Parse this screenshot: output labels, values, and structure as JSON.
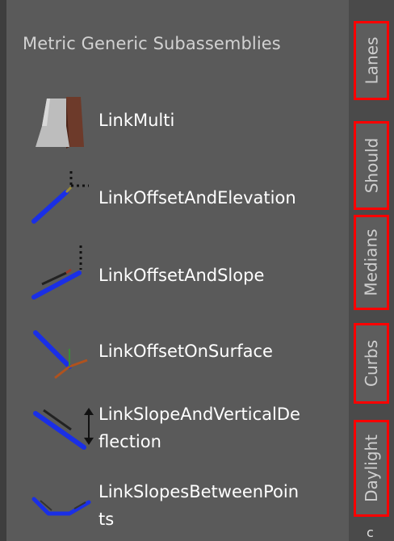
{
  "panel": {
    "title": "Metric Generic Subassemblies",
    "items": [
      {
        "label_lines": [
          "LinkMulti"
        ],
        "icon": "link-multi-icon"
      },
      {
        "label_lines": [
          "LinkOffsetAndElevation"
        ],
        "icon": "link-offset-elevation-icon"
      },
      {
        "label_lines": [
          "LinkOffsetAndSlope"
        ],
        "icon": "link-offset-slope-icon"
      },
      {
        "label_lines": [
          "LinkOffsetOnSurface"
        ],
        "icon": "link-offset-surface-icon"
      },
      {
        "label_lines": [
          "LinkSlopeAndVerticalDe",
          "flection"
        ],
        "icon": "link-slope-vertical-deflection-icon"
      },
      {
        "label_lines": [
          "LinkSlopesBetweenPoin",
          "ts"
        ],
        "icon": "link-slopes-between-points-icon"
      }
    ]
  },
  "tabs": [
    {
      "label": "Lanes"
    },
    {
      "label": "Should"
    },
    {
      "label": "Medians"
    },
    {
      "label": "Curbs"
    },
    {
      "label": "Daylight"
    }
  ],
  "tab_cut_glyph": "c",
  "colors": {
    "panel_bg": "#5a5a5a",
    "tab_strip_bg": "#4a4a4a",
    "highlight_border": "#ff0000",
    "link_blue": "#1a2fe6",
    "text": "#ffffff",
    "title_text": "#d2d2d2"
  }
}
